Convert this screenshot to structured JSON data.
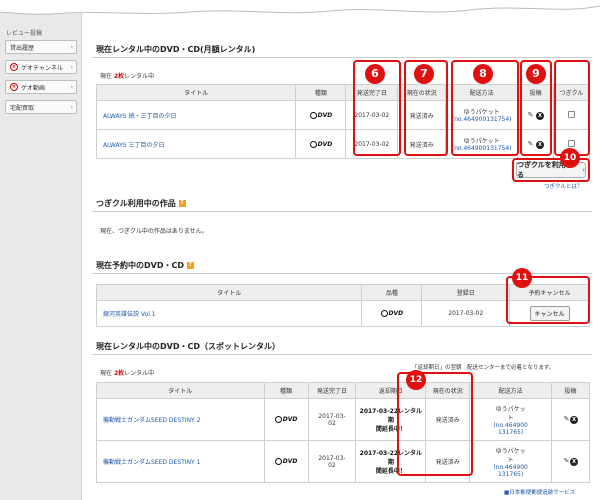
{
  "sidebar": {
    "top_text": "レビュー投稿",
    "items": [
      {
        "label": "貸出履歴",
        "icon": false
      },
      {
        "label": "ゲオチャンネル",
        "icon": true
      },
      {
        "label": "ゲオ動画",
        "icon": true
      },
      {
        "label": "宅配買取",
        "icon": false
      }
    ]
  },
  "section1": {
    "title": "現在レンタル中のDVD・CD(月額レンタル)",
    "count_prefix": "現在",
    "count_value": "2枚",
    "count_suffix": "レンタル中",
    "headers": [
      "タイトル",
      "種類",
      "発送完了日",
      "現在の状況",
      "配送方法",
      "投稿",
      "つぎクル"
    ],
    "rows": [
      {
        "title": "ALWAYS 続・三丁目の夕日",
        "type": "DVD",
        "date": "2017-03-02",
        "status": "発送済み",
        "method": "ゆうパケット",
        "tracking": "(no.464900131754)"
      },
      {
        "title": "ALWAYS 三丁目の夕日",
        "type": "DVD",
        "date": "2017-03-02",
        "status": "発送済み",
        "method": "ゆうパケット",
        "tracking": "(no.464900131754)"
      }
    ],
    "tsugi_button": "つぎクルを利用する",
    "tsugi_link": "つぎクルとは？"
  },
  "section2": {
    "title": "つぎクル利用中の作品",
    "message": "現在、つぎクル中の作品はありません。"
  },
  "section3": {
    "title": "現在予約中のDVD・CD",
    "headers": [
      "タイトル",
      "品種",
      "登録日",
      "予約キャンセル"
    ],
    "rows": [
      {
        "title": "銀河英雄伝説 Vol.1",
        "type": "DVD",
        "date": "2017-03-02",
        "cancel": "キャンセル"
      }
    ]
  },
  "section4": {
    "title": "現在レンタル中のDVD・CD（スポットレンタル）",
    "count_prefix": "現在",
    "count_value": "2枚",
    "count_suffix": "レンタル中",
    "note": "「返却期日」の翌朝　配送センターまで必着となります。",
    "headers": [
      "タイトル",
      "種類",
      "発送完了日",
      "返却期日",
      "現在の状況",
      "配送方法",
      "投稿"
    ],
    "rows": [
      {
        "title": "機動戦士ガンダムSEED DESTINY 2",
        "type": "DVD",
        "date1": "2017-03-",
        "date2": "02",
        "due1": "2017-03-22レンタル期",
        "due2": "間延長中！",
        "status": "発送済み",
        "m1": "ゆうパケッ",
        "m2": "ト",
        "t1": "(no.464900",
        "t2": "131765)"
      },
      {
        "title": "機動戦士ガンダムSEED DESTINY 1",
        "type": "DVD",
        "date1": "2017-03-",
        "date2": "02",
        "due1": "2017-03-22レンタル期",
        "due2": "間延長中！",
        "status": "発送済み",
        "m1": "ゆうパケッ",
        "m2": "ト",
        "t1": "(no.464900",
        "t2": "131765)"
      }
    ],
    "footer": "■日本郵便郵便追跡サービス"
  },
  "badges": [
    "6",
    "7",
    "8",
    "9",
    "10",
    "11",
    "12"
  ],
  "colors": {
    "accent_red": "#e01010",
    "link_blue": "#1e5aa8"
  }
}
